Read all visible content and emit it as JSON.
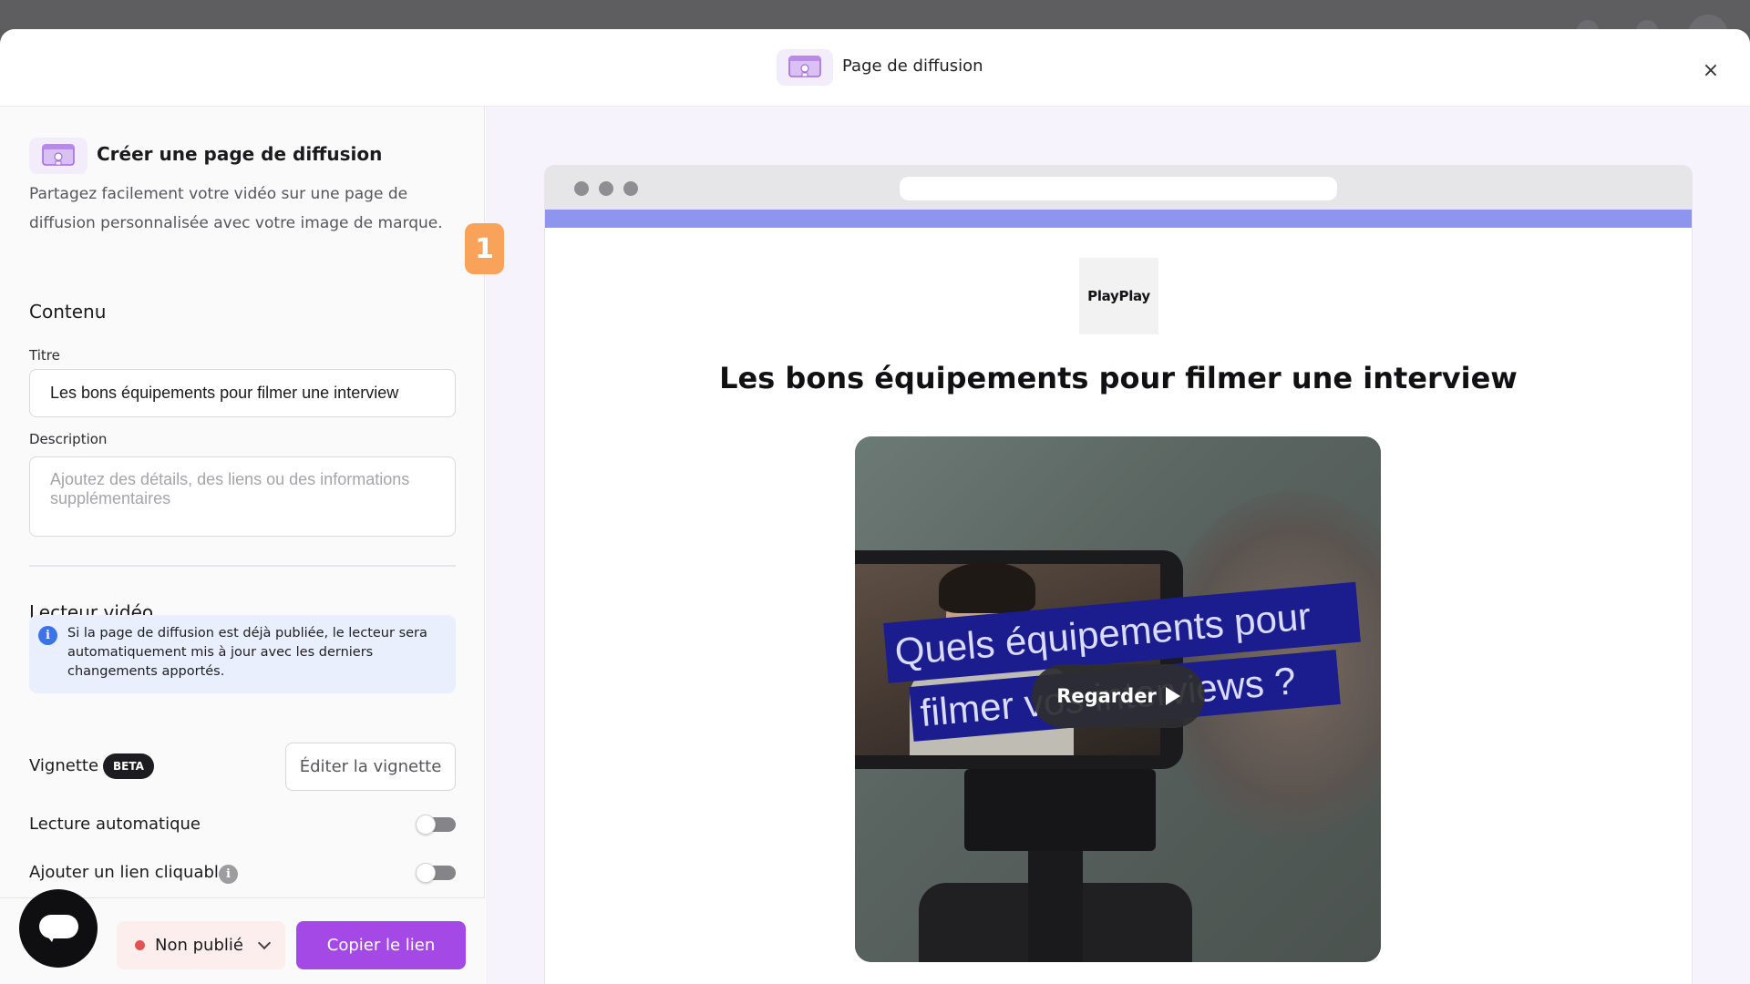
{
  "modal": {
    "title": "Page de diffusion",
    "close_icon": "×"
  },
  "left": {
    "header": {
      "title": "Créer une page de diffusion",
      "description": "Partagez facilement votre vidéo sur une page de diffusion personnalisée avec votre image de marque."
    },
    "step_badge": "1",
    "content": {
      "section_title": "Contenu",
      "title_label": "Titre",
      "title_value": "Les bons équipements pour filmer une interview",
      "description_label": "Description",
      "description_placeholder": "Ajoutez des détails, des liens ou des informations supplémentaires"
    },
    "player": {
      "section_title": "Lecteur vidéo",
      "info_icon": "i",
      "info_text": "Si la page de diffusion est déjà publiée, le lecteur sera automatiquement mis à jour avec les derniers changements apportés.",
      "thumbnail_label": "Vignette",
      "beta_label": "BETA",
      "edit_thumbnail_label": "Éditer la vignette",
      "autoplay_label": "Lecture automatique",
      "autoplay_on": false,
      "clickable_link_label": "Ajouter un lien cliquable",
      "help_icon": "i",
      "clickable_link_on": false
    },
    "footer": {
      "status_label": "Non publié",
      "status_color": "#e35252",
      "copy_link_label": "Copier le lien"
    }
  },
  "preview": {
    "logo_text": "PlayPlay",
    "page_title": "Les bons équipements pour filmer une interview",
    "video_overlay_line1": "Quels équipements pour",
    "video_overlay_line2": "filmer vos interviews ?",
    "watch_label": "Regarder",
    "brand_color": "#8e95ee"
  },
  "colors": {
    "accent": "#a549e6",
    "step_badge": "#f9a35a",
    "info_bg": "#e9effc",
    "info_icon": "#3b73e8"
  }
}
